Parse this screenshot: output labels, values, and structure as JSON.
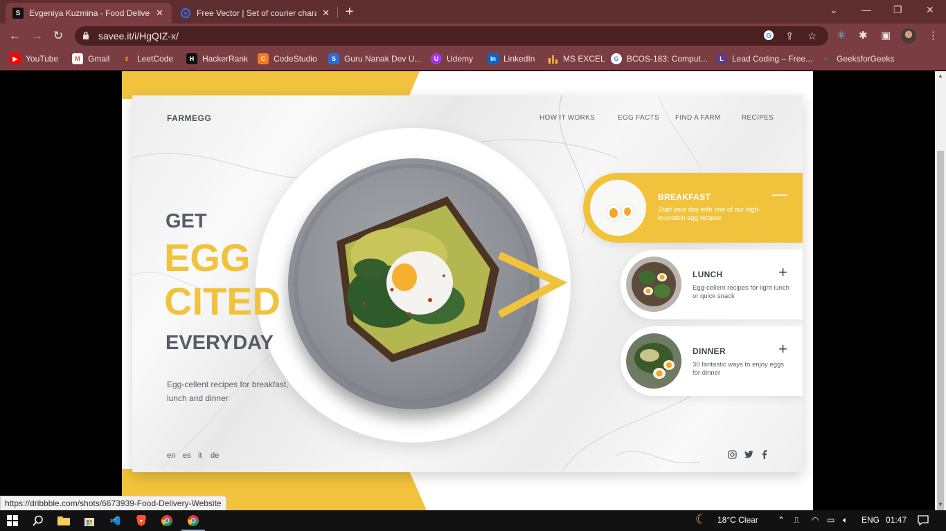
{
  "browser": {
    "tabs": [
      {
        "title": "Evgeniya Kuzmina - Food Deliver",
        "favicon": "S",
        "active": true
      },
      {
        "title": "Free Vector | Set of courier chara",
        "favicon": "freepik",
        "active": false
      }
    ],
    "url": "savee.it/i/HgQIZ-x/",
    "bookmarks": [
      {
        "label": "YouTube",
        "icon": "youtube-icon",
        "color": "#ff0000"
      },
      {
        "label": "Gmail",
        "icon": "gmail-icon",
        "color": "#ea4335"
      },
      {
        "label": "LeetCode",
        "icon": "leetcode-icon",
        "color": "#f89f1b"
      },
      {
        "label": "HackerRank",
        "icon": "hackerrank-icon",
        "color": "#1ba94c"
      },
      {
        "label": "CodeStudio",
        "icon": "codestudio-icon",
        "color": "#f47a20"
      },
      {
        "label": "Guru Nanak Dev U...",
        "icon": "gndu-icon",
        "color": "#2a6cd6"
      },
      {
        "label": "Udemy",
        "icon": "udemy-icon",
        "color": "#a435f0"
      },
      {
        "label": "LinkedIn",
        "icon": "linkedin-icon",
        "color": "#0a66c2"
      },
      {
        "label": "MS EXCEL",
        "icon": "chart-icon",
        "color": "#f1c33c"
      },
      {
        "label": "BCOS-183: Comput...",
        "icon": "google-icon",
        "color": "#ffffff"
      },
      {
        "label": "Lead Coding – Free...",
        "icon": "leadcoding-icon",
        "color": "#5b3c8c"
      },
      {
        "label": "GeeksforGeeks",
        "icon": "gfg-icon",
        "color": "#2f8d46"
      }
    ],
    "status_url": "https://dribbble.com/shots/6673939-Food-Delivery-Website"
  },
  "site": {
    "brand": "FARMEGG",
    "nav": [
      "HOW IT WORKS",
      "EGG FACTS",
      "FIND A FARM",
      "RECIPES"
    ],
    "hero": {
      "line1": "GET",
      "line2": "EGG",
      "line3": "CITED",
      "line4": "EVERYDAY",
      "subtitle": "Egg-cellent recipes for breakfast, lunch and dinner"
    },
    "languages": [
      "en",
      "es",
      "it",
      "de"
    ],
    "social": [
      "instagram-icon",
      "twitter-icon",
      "facebook-icon"
    ],
    "meals": [
      {
        "title": "BREAKFAST",
        "desc": "Start your day with one of our high-in-protein egg recipes",
        "toggle": "—",
        "active": true
      },
      {
        "title": "LUNCH",
        "desc": "Egg-cellent recipes for light lunch or quick snack",
        "toggle": "+",
        "active": false
      },
      {
        "title": "DINNER",
        "desc": "30 fantastic ways to enjoy eggs for dinner",
        "toggle": "+",
        "active": false
      }
    ],
    "colors": {
      "accent": "#f1c33c",
      "text": "#555c66"
    }
  },
  "taskbar": {
    "weather": "18°C  Clear",
    "lang": "ENG",
    "time": "01:47"
  }
}
